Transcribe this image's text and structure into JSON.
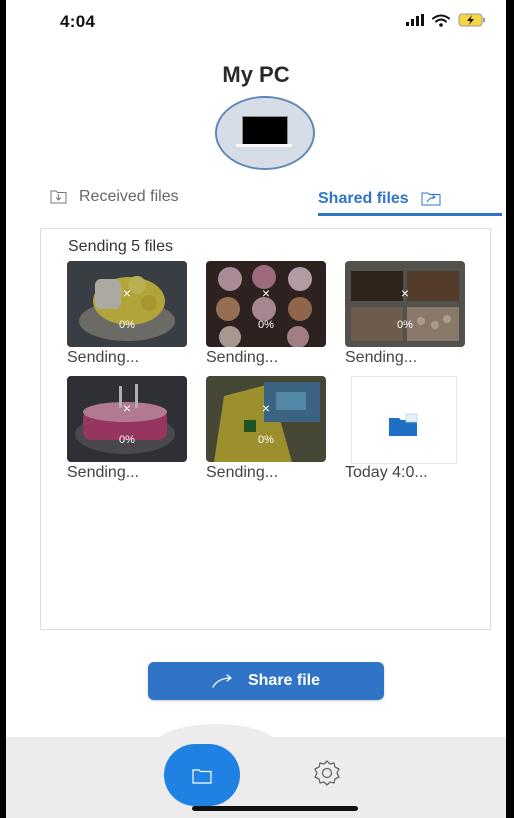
{
  "status_bar": {
    "time": "4:04"
  },
  "header": {
    "title": "My PC"
  },
  "tabs": {
    "received_label": "Received files",
    "shared_label": "Shared files",
    "active": "shared"
  },
  "panel": {
    "title": "Sending 5 files",
    "items": [
      {
        "label": "Sending...",
        "progress": "0%",
        "cancel": "×",
        "thumb": "cake-yellow-white"
      },
      {
        "label": "Sending...",
        "progress": "0%",
        "cancel": "×",
        "thumb": "cupcakes"
      },
      {
        "label": "Sending...",
        "progress": "0%",
        "cancel": "×",
        "thumb": "cookies-box"
      },
      {
        "label": "Sending...",
        "progress": "0%",
        "cancel": "×",
        "thumb": "cake-pink"
      },
      {
        "label": "Sending...",
        "progress": "0%",
        "cancel": "×",
        "thumb": "bag-yellow"
      },
      {
        "label": "Today 4:0...",
        "thumb": "folder-document"
      }
    ]
  },
  "actions": {
    "share_label": "Share file"
  },
  "bottom_nav": {
    "files_icon": "folder-icon",
    "settings_icon": "gear-icon"
  },
  "colors": {
    "accent": "#2f74c6",
    "nav_accent": "#1f82e3"
  }
}
